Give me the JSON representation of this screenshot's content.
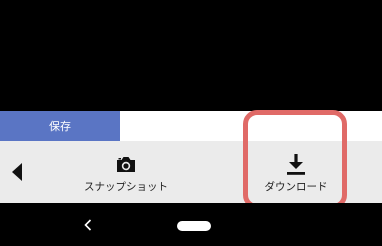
{
  "tabs": {
    "save_label": "保存"
  },
  "toolbar": {
    "back_icon": "chevron-left-icon",
    "snapshot": {
      "icon": "camera-icon",
      "label": "スナップショット"
    },
    "download": {
      "icon": "download-icon",
      "label": "ダウンロード"
    }
  },
  "nav": {
    "back_icon": "chevron-left-icon",
    "home_icon": "home-pill-icon"
  },
  "colors": {
    "save_tab_bg": "#5a75c4",
    "toolbar_bg": "#ebebeb",
    "highlight": "#e06a67"
  }
}
